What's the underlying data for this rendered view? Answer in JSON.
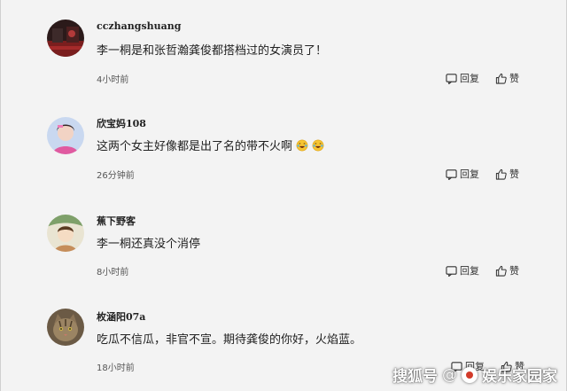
{
  "reply_label": "回复",
  "like_label": "赞",
  "comments": [
    {
      "username": "cczhangshuang",
      "text": "李一桐是和张哲瀚龚俊都搭档过的女演员了！",
      "time": "4小时前",
      "avatar": "avatar-dark-red-scene",
      "emojis": []
    },
    {
      "username": "欣宝妈108",
      "text": "这两个女主好像都是出了名的带不火啊",
      "time": "26分钟前",
      "avatar": "avatar-girl-pink",
      "emojis": [
        "laughing-tears-emoji",
        "laughing-tears-emoji"
      ]
    },
    {
      "username": "蕉下野客",
      "text": "李一桐还真没个消停",
      "time": "8小时前",
      "avatar": "avatar-illustrated-child",
      "emojis": []
    },
    {
      "username": "枚涵阳07a",
      "text": "吃瓜不信瓜，非官不宣。期待龚俊的你好，火焰蓝。",
      "time": "18小时前",
      "avatar": "avatar-tabby-cat",
      "emojis": []
    }
  ],
  "watermark": {
    "brand": "搜狐号",
    "separator": "@",
    "account": "娱乐家园家"
  }
}
